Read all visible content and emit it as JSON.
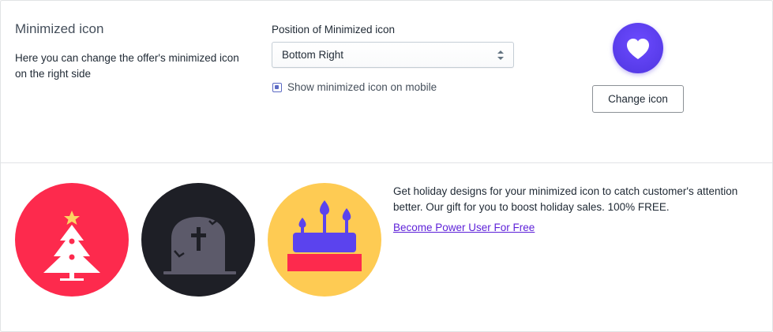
{
  "settings": {
    "title": "Minimized icon",
    "description": "Here you can change the offer's minimized icon on the right side",
    "position_label": "Position of Minimized icon",
    "position_value": "Bottom Right",
    "mobile_checkbox_label": "Show minimized icon on mobile",
    "mobile_checkbox_checked": true,
    "change_icon_button": "Change icon",
    "preview_icon": "heart-icon",
    "accent_color": "#5c3bf0"
  },
  "holiday": {
    "text": "Get holiday designs for your minimized icon to catch customer's attention better. Our gift for you to boost holiday sales. 100% FREE.",
    "link": "Become Power User For Free",
    "designs": [
      {
        "icon": "christmas-tree-icon",
        "color": "#fd2a4d"
      },
      {
        "icon": "tombstone-icon",
        "color": "#1e1f26"
      },
      {
        "icon": "birthday-cake-icon",
        "color": "#fecb53"
      }
    ]
  }
}
